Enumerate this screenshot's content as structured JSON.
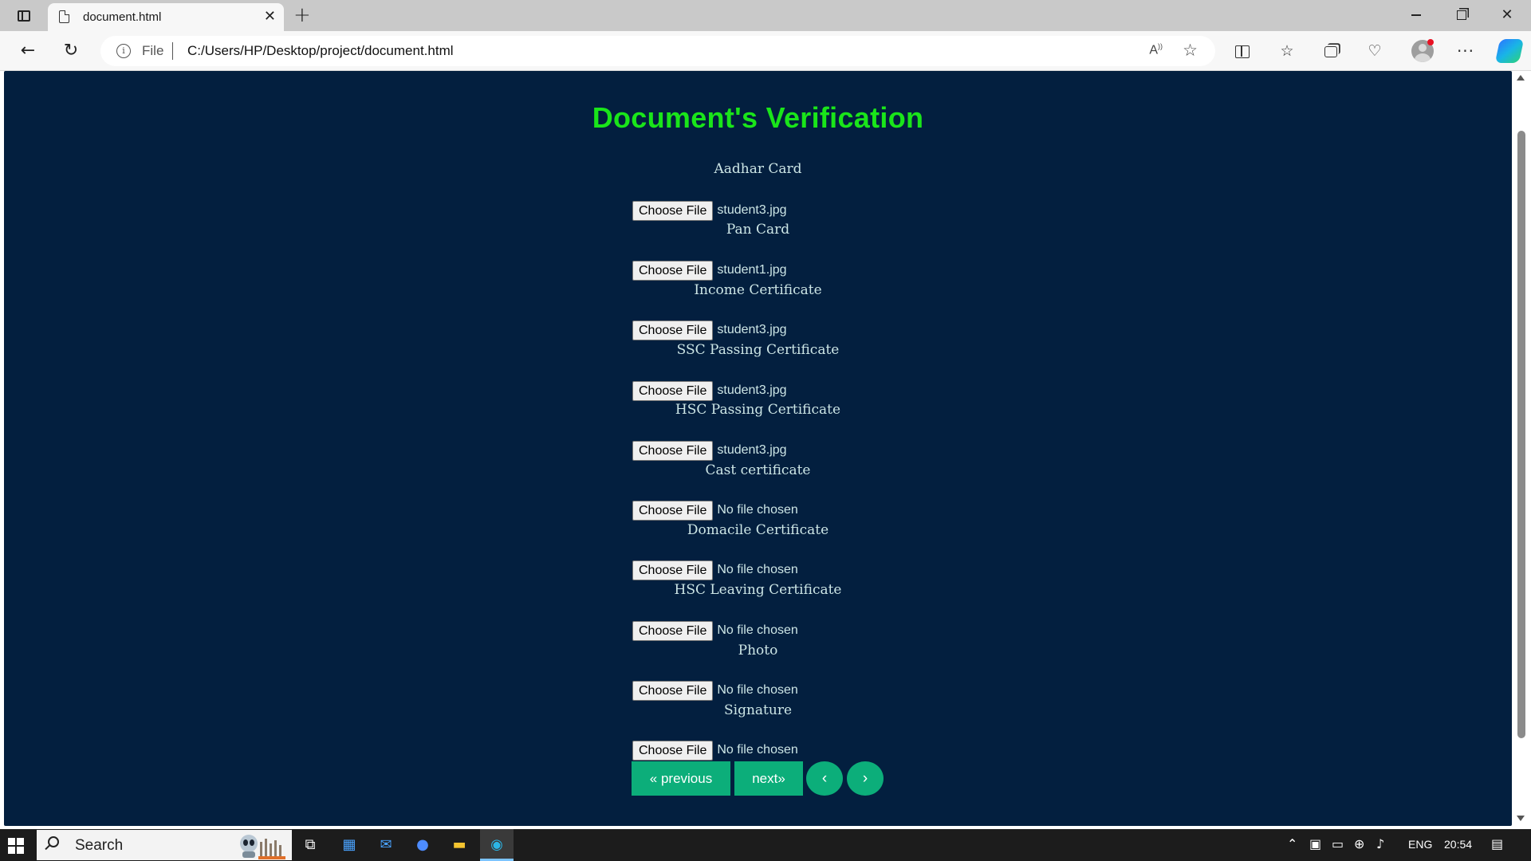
{
  "browser": {
    "tab_title": "document.html",
    "tab_close": "✕",
    "new_tab": "+",
    "address": {
      "scheme_label": "File",
      "url": "C:/Users/HP/Desktop/project/document.html"
    }
  },
  "page": {
    "title": "Document's Verification",
    "title_color": "#1ae51a",
    "background_color": "#031f3f",
    "button_label": "Choose File",
    "documents": [
      {
        "label": "Aadhar Card",
        "file": "student3.jpg"
      },
      {
        "label": "Pan Card",
        "file": "student1.jpg"
      },
      {
        "label": "Income Certificate",
        "file": "student3.jpg"
      },
      {
        "label": "SSC Passing Certificate",
        "file": "student3.jpg"
      },
      {
        "label": "HSC Passing Certificate",
        "file": "student3.jpg"
      },
      {
        "label": "Cast certificate",
        "file": "No file chosen"
      },
      {
        "label": "Domacile Certificate",
        "file": "No file chosen"
      },
      {
        "label": "HSC Leaving Certificate",
        "file": "No file chosen"
      },
      {
        "label": "Photo",
        "file": "No file chosen"
      },
      {
        "label": "Signature",
        "file": "No file chosen"
      }
    ],
    "pagination": {
      "previous": "« previous",
      "next": "next»",
      "left_arrow": "‹",
      "right_arrow": "›",
      "color": "#0cae7a"
    }
  },
  "taskbar": {
    "search_placeholder": "Search",
    "language": "ENG",
    "time": "20:54"
  }
}
